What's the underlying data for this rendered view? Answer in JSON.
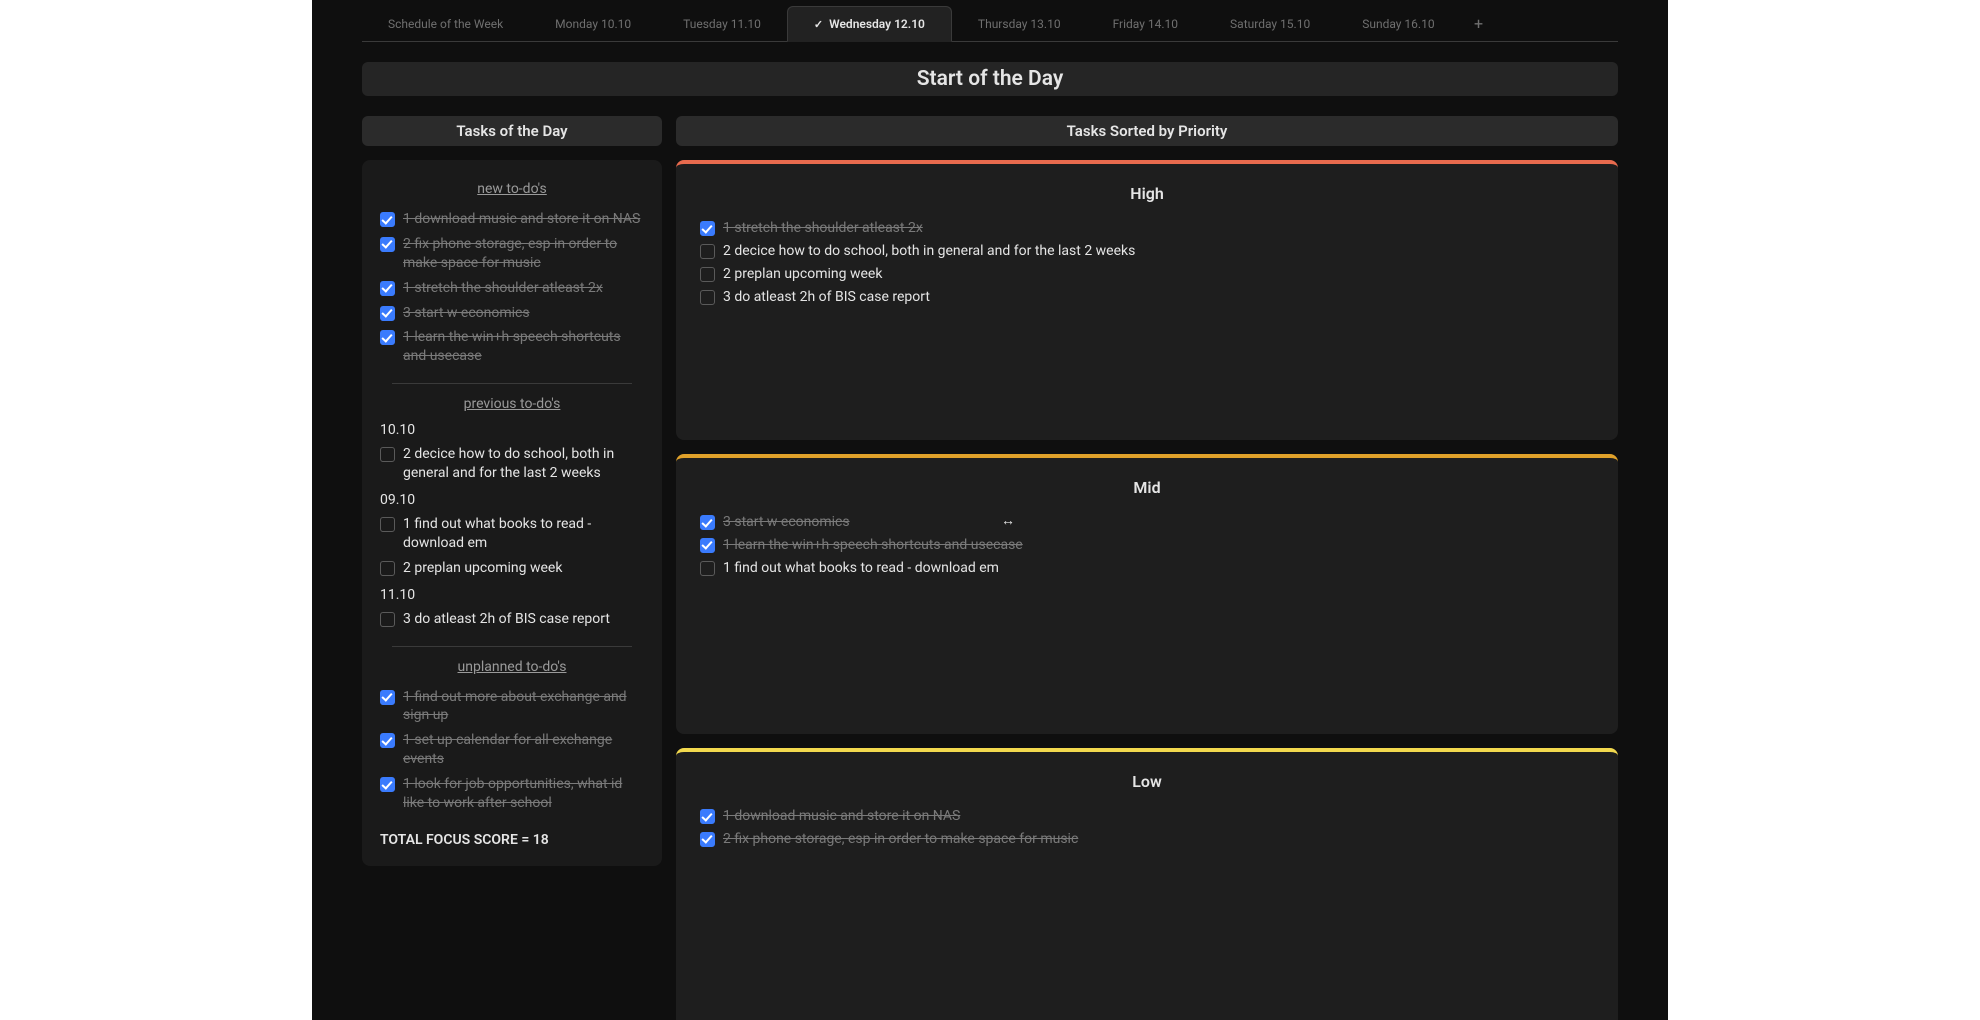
{
  "tabs": [
    {
      "label": "Schedule of the Week",
      "active": false
    },
    {
      "label": "Monday 10.10",
      "active": false
    },
    {
      "label": "Tuesday 11.10",
      "active": false
    },
    {
      "label": "Wednesday 12.10",
      "active": true
    },
    {
      "label": "Thursday 13.10",
      "active": false
    },
    {
      "label": "Friday 14.10",
      "active": false
    },
    {
      "label": "Saturday 15.10",
      "active": false
    },
    {
      "label": "Sunday 16.10",
      "active": false
    }
  ],
  "page_title": "Start of the Day",
  "left": {
    "title": "Tasks of the Day",
    "new_section": "new to-do's",
    "prev_section": "previous to-do's",
    "unplanned_section": "unplanned to-do's",
    "new_tasks": [
      {
        "done": true,
        "text": "1 download music and store it on NAS"
      },
      {
        "done": true,
        "text": "2 fix phone storage, esp in order to make space for music"
      },
      {
        "done": true,
        "text": "1 stretch the shoulder atleast 2x"
      },
      {
        "done": true,
        "text": "3 start w economics"
      },
      {
        "done": true,
        "text": "1 learn the win+h speech shortcuts and usecase"
      }
    ],
    "prev_groups": [
      {
        "date": "10.10",
        "tasks": [
          {
            "done": false,
            "text": "2 decice how to do school, both in general and for the last 2 weeks"
          }
        ]
      },
      {
        "date": "09.10",
        "tasks": [
          {
            "done": false,
            "text": "1 find out what books to read - download em"
          },
          {
            "done": false,
            "text": "2 preplan upcoming week"
          }
        ]
      },
      {
        "date": "11.10",
        "tasks": [
          {
            "done": false,
            "text": "3 do atleast 2h of BIS case report"
          }
        ]
      }
    ],
    "unplanned_tasks": [
      {
        "done": true,
        "text": "1 find out more about exchange and sign up"
      },
      {
        "done": true,
        "text": "1 set up calendar for all exchange events"
      },
      {
        "done": true,
        "text": "1 look for job opportunities, what id like to work after school"
      }
    ],
    "score_label": "TOTAL FOCUS SCORE = 18"
  },
  "right": {
    "title": "Tasks Sorted by Priority",
    "high_title": "High",
    "mid_title": "Mid",
    "low_title": "Low",
    "high": [
      {
        "done": true,
        "text": "1 stretch the shoulder atleast 2x"
      },
      {
        "done": false,
        "text": "2 decice how to do school, both in general and for the last 2 weeks"
      },
      {
        "done": false,
        "text": "2 preplan upcoming week"
      },
      {
        "done": false,
        "text": "3 do atleast 2h of BIS case report"
      }
    ],
    "mid": [
      {
        "done": true,
        "text": "3 start w economics"
      },
      {
        "done": true,
        "text": "1 learn the win+h speech shortcuts and usecase"
      },
      {
        "done": false,
        "text": "1 find out what books to read - download em"
      }
    ],
    "low": [
      {
        "done": true,
        "text": "1 download music and store it on NAS"
      },
      {
        "done": true,
        "text": "2 fix phone storage, esp in order to make space for music"
      }
    ]
  }
}
